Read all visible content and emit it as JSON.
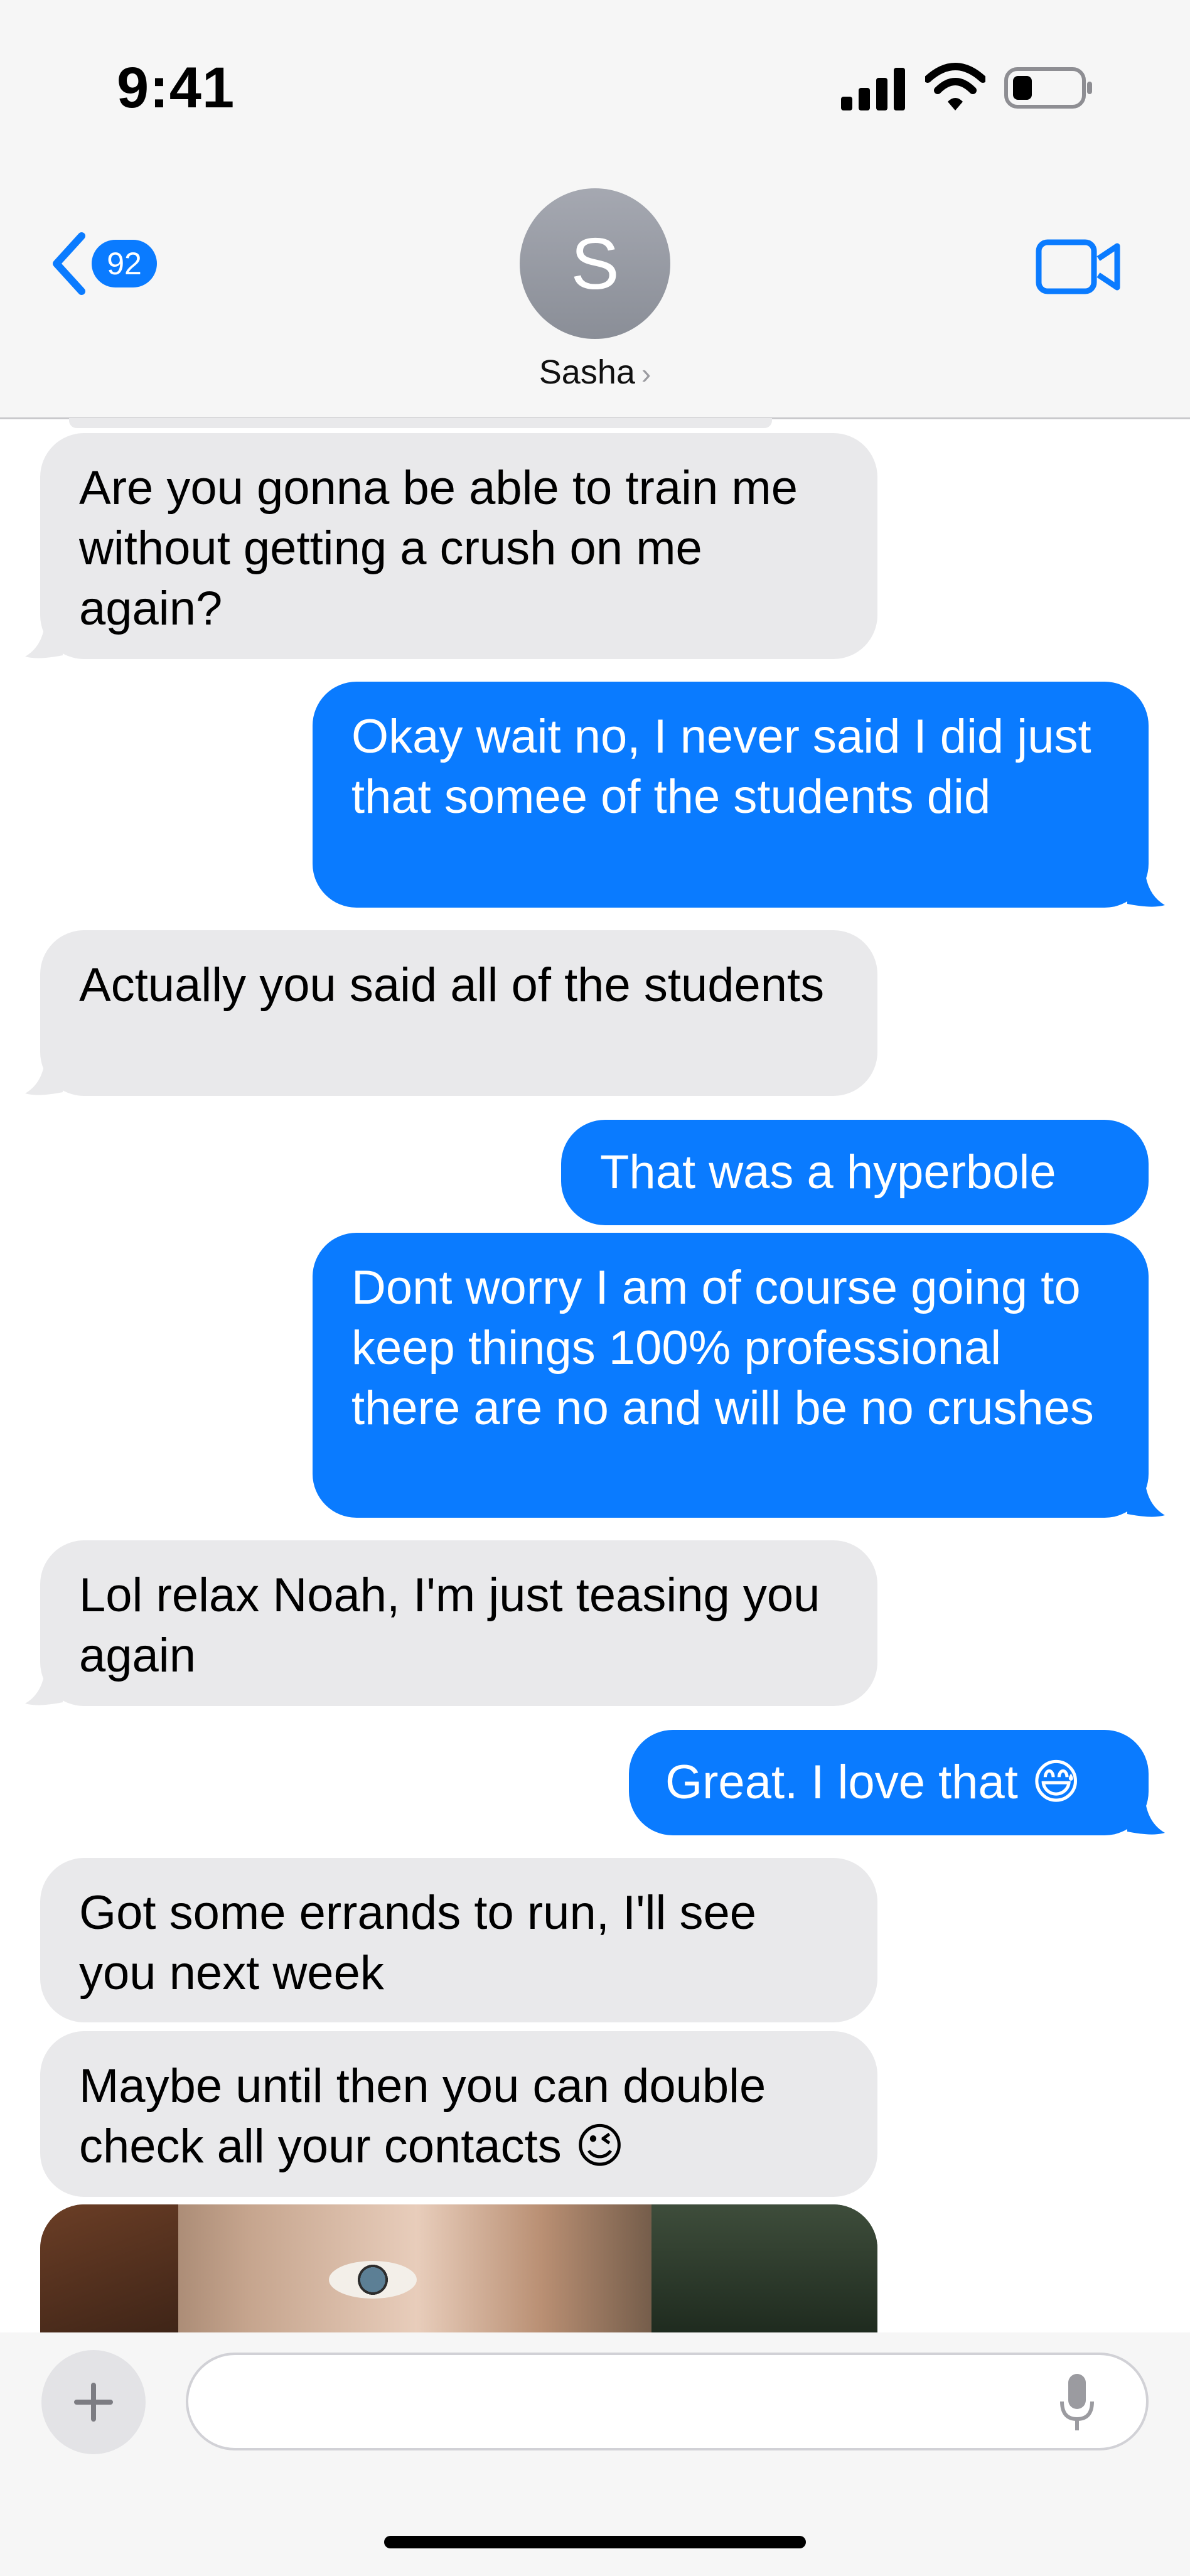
{
  "status_bar": {
    "time": "9:41"
  },
  "header": {
    "back_badge": "92",
    "avatar_initial": "S",
    "contact_name": "Sasha",
    "name_chevron": "›"
  },
  "messages": [
    {
      "direction": "incoming",
      "text": "Are you gonna be able to train me without getting a crush on me again?"
    },
    {
      "direction": "outgoing",
      "text": "Okay wait no, I never said I did just that somee of the students did"
    },
    {
      "direction": "incoming",
      "text": "Actually you said all of the students"
    },
    {
      "direction": "outgoing",
      "text": "That was a hyperbole"
    },
    {
      "direction": "outgoing",
      "text": "Dont worry I am of course going to keep things 100% professional there are no and will be no crushes"
    },
    {
      "direction": "incoming",
      "text": "Lol relax Noah, I'm just teasing you again"
    },
    {
      "direction": "outgoing",
      "text": "Great. I love that 😅"
    },
    {
      "direction": "incoming",
      "text": "Got some errands to run, I'll see you next week"
    },
    {
      "direction": "incoming",
      "text": "Maybe until then you can double check all your contacts 😉"
    }
  ],
  "compose": {
    "plus_label": "+"
  },
  "colors": {
    "outgoing_bubble": "#0a7bff",
    "incoming_bubble": "#e9e9eb",
    "accent": "#0a7bff"
  }
}
